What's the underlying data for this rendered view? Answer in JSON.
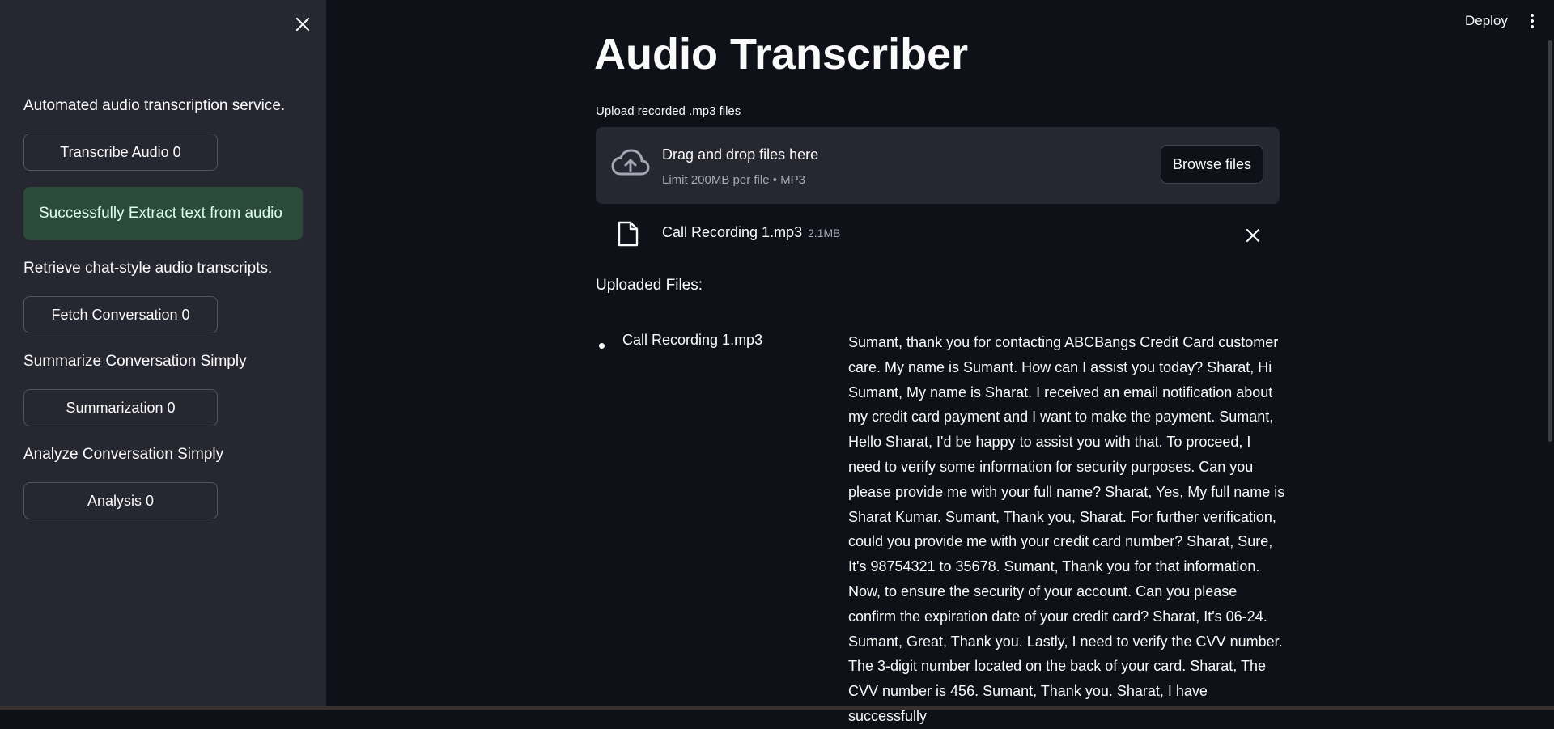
{
  "sidebar": {
    "intro_text": "Automated audio transcription service.",
    "transcribe_button": "Transcribe Audio 0",
    "success_message": "Successfully Extract text from audio",
    "retrieve_text": "Retrieve chat-style audio transcripts.",
    "fetch_button": "Fetch Conversation 0",
    "summarize_text": "Summarize Conversation Simply",
    "summarization_button": "Summarization 0",
    "analyze_text": "Analyze Conversation Simply",
    "analysis_button": "Analysis 0",
    "close_icon": "close-icon"
  },
  "header": {
    "deploy_label": "Deploy",
    "menu_icon": "vertical-dots-icon"
  },
  "main": {
    "title": "Audio Transcriber",
    "upload_label": "Upload recorded .mp3 files",
    "dropzone": {
      "icon": "cloud-upload-icon",
      "title": "Drag and drop files here",
      "subtitle": "Limit 200MB per file • MP3",
      "browse_label": "Browse files"
    },
    "uploaded_file": {
      "icon": "file-icon",
      "name": "Call Recording 1.mp3",
      "size": "2.1MB",
      "remove_icon": "close-icon"
    },
    "uploaded_heading": "Uploaded Files:",
    "uploaded_list": [
      {
        "name": "Call Recording 1.mp3",
        "transcript": "Sumant, thank you for contacting ABCBangs Credit Card customer care. My name is Sumant. How can I assist you today? Sharat, Hi Sumant, My name is Sharat. I received an email notification about my credit card payment and I want to make the payment. Sumant, Hello Sharat, I'd be happy to assist you with that. To proceed, I need to verify some information for security purposes. Can you please provide me with your full name? Sharat, Yes, My full name is Sharat Kumar. Sumant, Thank you, Sharat. For further verification, could you provide me with your credit card number? Sharat, Sure, It's 98754321 to 35678. Sumant, Thank you for that information. Now, to ensure the security of your account. Can you please confirm the expiration date of your credit card? Sharat, It's 06-24. Sumant, Great, Thank you. Lastly, I need to verify the CVV number. The 3-digit number located on the back of your card. Sharat, The CVV number is 456. Sumant, Thank you. Sharat, I have successfully"
      }
    ]
  },
  "colors": {
    "background": "#0e1117",
    "sidebar": "#262730",
    "success_bg": "#2b4a3a",
    "success_text": "#dffde9",
    "muted_text": "#a3a8b4"
  }
}
